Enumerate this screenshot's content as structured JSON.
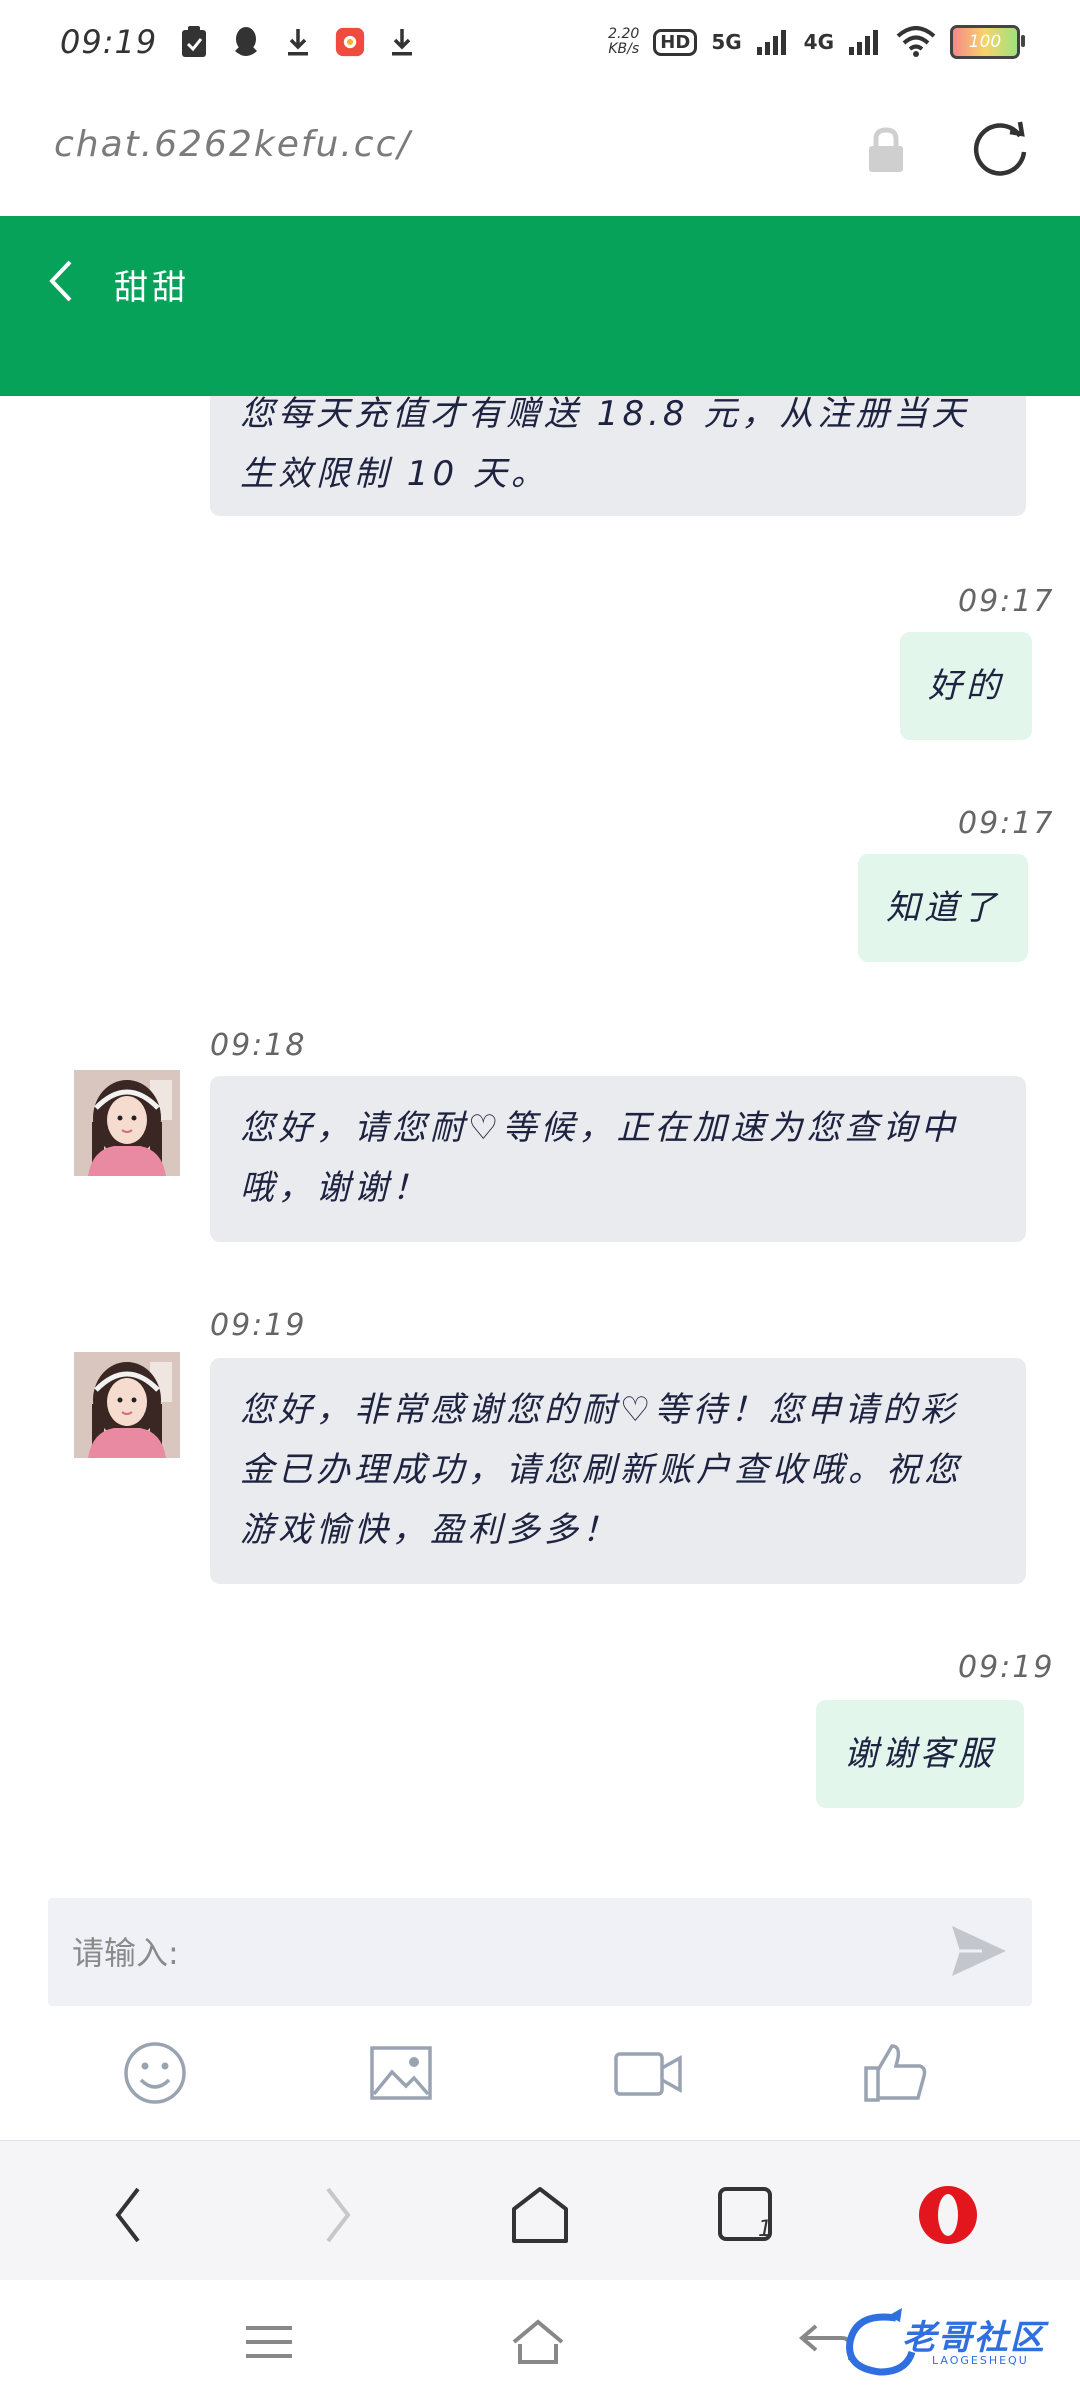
{
  "status_bar": {
    "time": "09:19",
    "net_speed_value": "2.20",
    "net_speed_unit": "KB/s",
    "hd_label": "HD",
    "net_5g": "5G",
    "net_4g": "4G",
    "battery": "100",
    "icons": [
      "check-clipboard-icon",
      "qq-icon",
      "download-icon",
      "app-icon",
      "download-icon",
      "wifi-icon",
      "signal-icon"
    ]
  },
  "browser": {
    "url": "chat.6262kefu.cc/",
    "tab_count": "1"
  },
  "header": {
    "title": "甜甜",
    "color": "#06a25a"
  },
  "messages": [
    {
      "from": "agent",
      "time": "",
      "text": "您每天充值才有赠送 18.8 元，从注册当天生效限制 10 天。"
    },
    {
      "from": "me",
      "time": "09:17",
      "text": "好的"
    },
    {
      "from": "me",
      "time": "09:17",
      "text": "知道了"
    },
    {
      "from": "agent",
      "time": "09:18",
      "text": "您好，请您耐♡等候，正在加速为您查询中哦，谢谢！"
    },
    {
      "from": "agent",
      "time": "09:19",
      "text": "您好，非常感谢您的耐♡等待！您申请的彩金已办理成功，请您刷新账户查收哦。祝您游戏愉快，盈利多多！"
    },
    {
      "from": "me",
      "time": "09:19",
      "text": "谢谢客服"
    }
  ],
  "input": {
    "placeholder": "请输入:"
  },
  "toolbar": [
    "emoji-icon",
    "image-icon",
    "video-icon",
    "thumbs-up-icon"
  ],
  "watermark": {
    "text": "老哥社区",
    "sub": "LAOGESHEQU"
  }
}
